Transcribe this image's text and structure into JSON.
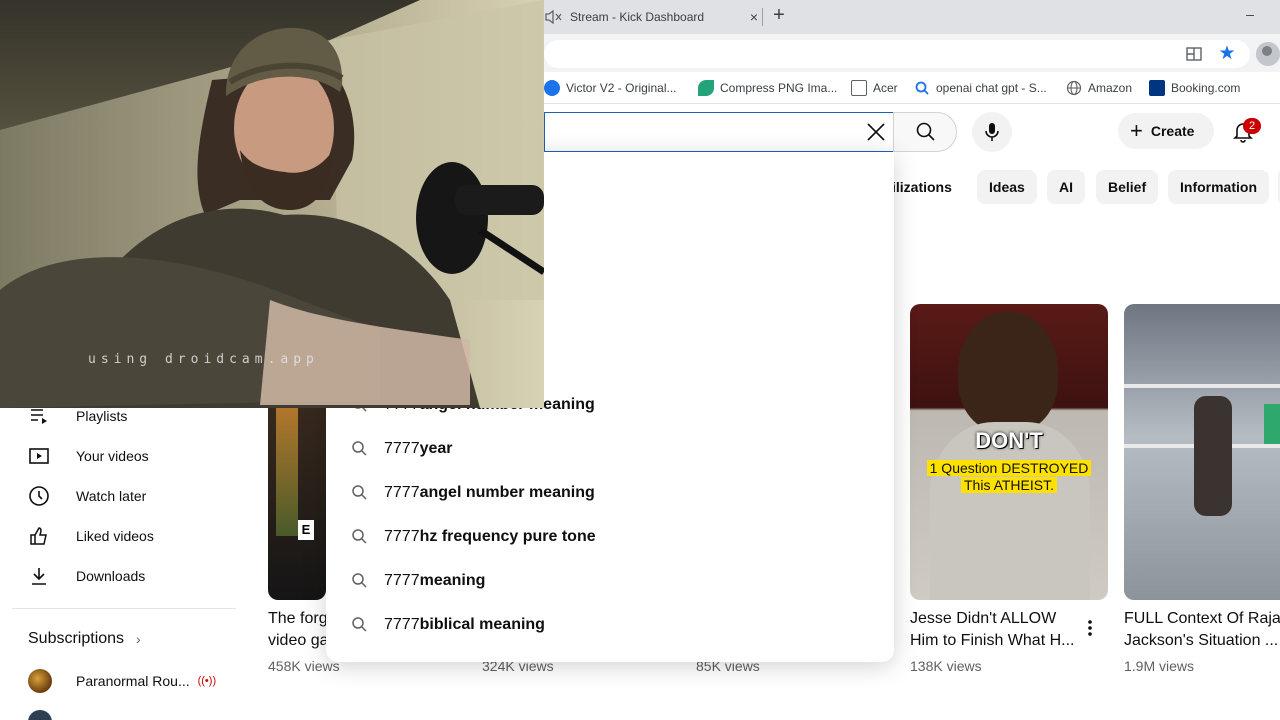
{
  "browser": {
    "tab": {
      "title": "Stream - Kick Dashboard",
      "close": "×"
    },
    "new_tab": "+",
    "minimize": "–",
    "bookmarks": [
      {
        "label": "Victor V2 - Original...",
        "icon": "globe-blue",
        "color": "#1a73e8"
      },
      {
        "label": "Compress PNG Ima...",
        "icon": "leaf",
        "color": "#24a37a"
      },
      {
        "label": "Acer",
        "icon": "folder",
        "color": "#5f6368"
      },
      {
        "label": "openai chat gpt - S...",
        "icon": "search",
        "color": "#1a73e8"
      },
      {
        "label": "Amazon",
        "icon": "globe",
        "color": "#5f6368"
      },
      {
        "label": "Booking.com",
        "icon": "booking",
        "color": "#003580"
      }
    ]
  },
  "header": {
    "create_label": "Create",
    "notification_count": "2"
  },
  "chips": [
    "ilizations",
    "Ideas",
    "AI",
    "Belief",
    "Information"
  ],
  "sidebar": {
    "items": [
      {
        "label": "Playlists",
        "icon": "playlist-icon"
      },
      {
        "label": "Your videos",
        "icon": "your-videos-icon"
      },
      {
        "label": "Watch later",
        "icon": "clock-icon"
      },
      {
        "label": "Liked videos",
        "icon": "thumbs-up-icon"
      },
      {
        "label": "Downloads",
        "icon": "download-icon"
      }
    ],
    "subscriptions_label": "Subscriptions",
    "subscriptions_chevron": "›",
    "subscriptions": [
      {
        "label": "Paranormal Rou...",
        "live": "((•))"
      }
    ]
  },
  "suggestions": [
    {
      "prefix": "7777",
      "rest": " angel number meaning"
    },
    {
      "prefix": "7777",
      "rest": " year"
    },
    {
      "prefix": "7777",
      "rest": " angel number meaning"
    },
    {
      "prefix": "7777",
      "rest": " hz frequency pure tone"
    },
    {
      "prefix": "7777",
      "rest": " meaning"
    },
    {
      "prefix": "7777",
      "rest": " biblical meaning"
    }
  ],
  "videos": [
    {
      "title_line1": "The forg",
      "title_line2": "video ga",
      "views": "458K views"
    },
    {
      "title_line1": "",
      "title_line2": "",
      "views": "324K views"
    },
    {
      "title_line1": "",
      "title_line2": "",
      "views": "85K views"
    },
    {
      "title_line1": "Jesse Didn't ALLOW",
      "title_line2": "Him to Finish What H...",
      "views": "138K views",
      "thumb_text_big": "DON'T",
      "thumb_caption_1": "1 Question DESTROYED",
      "thumb_caption_2": "This ATHEIST."
    },
    {
      "title_line1": "FULL Context Of Raja",
      "title_line2": "Jackson's Situation ...",
      "views": "1.9M views"
    }
  ],
  "webcam": {
    "watermark": "using droidcam.app"
  }
}
